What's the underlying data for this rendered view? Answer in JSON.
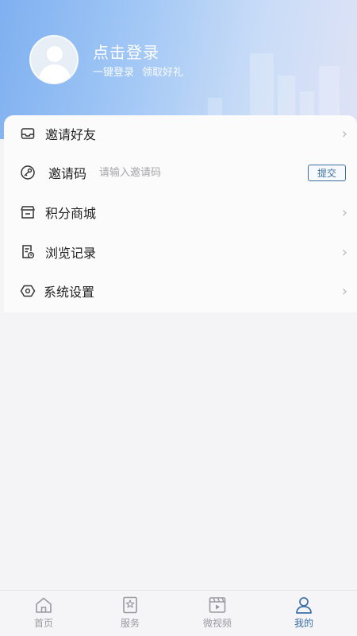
{
  "header": {
    "login_title": "点击登录",
    "login_sub_1": "一键登录",
    "login_sub_2": "领取好礼"
  },
  "menu": {
    "invite_friends": "邀请好友",
    "invite_code": "邀请码",
    "invite_code_placeholder": "请输入邀请码",
    "submit": "提交",
    "points_mall": "积分商城",
    "history": "浏览记录",
    "settings": "系统设置",
    "chevron": "›"
  },
  "tabbar": {
    "home": "首页",
    "services": "服务",
    "micro_video": "微视频",
    "mine": "我的"
  },
  "colors": {
    "accent": "#3b6fa8",
    "header_start": "#7fb0f0",
    "header_end": "#dfe3f6"
  },
  "icons": {
    "invite_friends": "inbox-icon",
    "invite_code": "key-icon",
    "points_mall": "store-icon",
    "history": "receipt-icon",
    "settings": "hexagon-gear-icon",
    "home": "home-icon",
    "services": "bookmark-star-icon",
    "micro_video": "clapper-icon",
    "mine": "user-icon"
  }
}
